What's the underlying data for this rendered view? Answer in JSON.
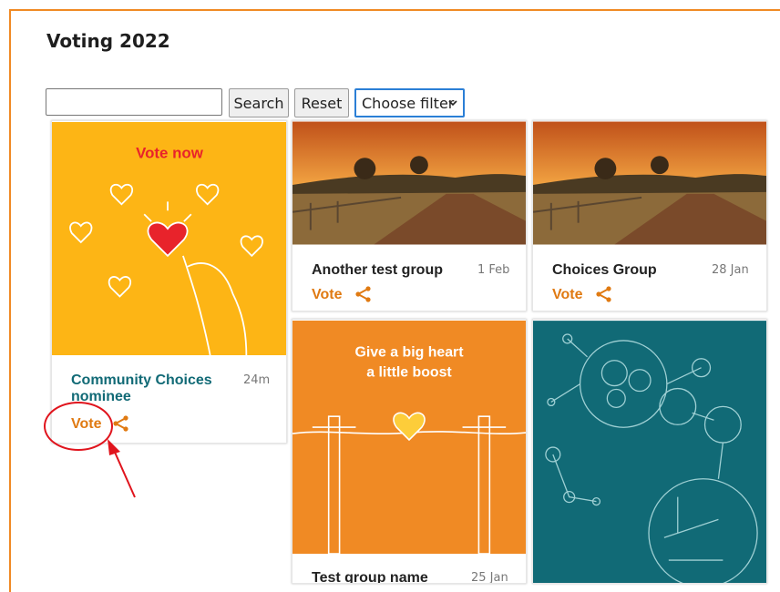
{
  "page": {
    "title": "Voting 2022"
  },
  "toolbar": {
    "search_value": "",
    "search_label": "Search",
    "reset_label": "Reset",
    "filter_selected": "Choose filter"
  },
  "cards": [
    {
      "title": "Community Choices nominee",
      "time": "24m",
      "vote_label": "Vote",
      "image_text": "Vote now"
    },
    {
      "title": "Another test group",
      "time": "1 Feb",
      "vote_label": "Vote"
    },
    {
      "title": "Choices Group",
      "time": "28 Jan",
      "vote_label": "Vote"
    },
    {
      "title": "Test group name",
      "time": "25 Jan",
      "image_text_line1": "Give a big heart",
      "image_text_line2": "a little boost"
    }
  ],
  "colors": {
    "accent": "#e07a12",
    "title_teal": "#116a76",
    "frame": "#f08a24",
    "annotation": "#e0141d"
  }
}
